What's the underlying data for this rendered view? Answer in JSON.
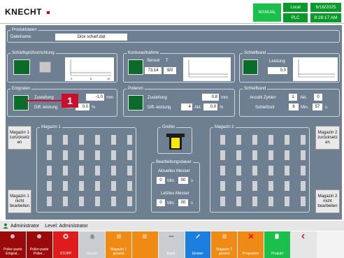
{
  "topbar": {
    "logo": "KNECHT",
    "mode": "MANUAL",
    "local": "Local",
    "plc": "PLC",
    "date": "6/16/2025",
    "time": "8:28:17 AM"
  },
  "produktdaten": {
    "title": "Produktdaten",
    "dateiname_label": "Dateiname:",
    "dateiname_value": "Dick scharf.dat"
  },
  "schaerfe": {
    "title": "Schärfeprüfvorrichtung",
    "graph_ticks": [
      "0",
      "8",
      "16"
    ]
  },
  "kontur": {
    "title": "Konturaufnahme",
    "sensor_label": "Sensor",
    "sensor_t": "T",
    "value1": "73.14",
    "value2": "9/0"
  },
  "schleifband_top": {
    "title": "Schleifband",
    "leistung_label": "Leistung",
    "leistung_value": "0.0"
  },
  "entgraten": {
    "title": "Entgraten",
    "zustellung_label": "Zustellung",
    "zustellung_value": "-1.0",
    "zustellung_unit": "mm",
    "diff_label": "Diff.-leistung",
    "akt_label": "Akt.",
    "akt_value": "0.0",
    "akt_unit": "%"
  },
  "polieren": {
    "title": "Polieren",
    "zustellung_label": "Zustellung",
    "zustellung_value": "0.8",
    "zustellung_unit": "mm",
    "diff_label": "Diff.-leistung",
    "diff_value": "4",
    "akt_label": "Akt.",
    "akt_value": "0.0",
    "akt_unit": "%"
  },
  "schleifband_bottom": {
    "title": "Schleifband",
    "zyklen_label": "Anzahl Zyklen",
    "zyklen_value": "1",
    "akt_label": "Akt.",
    "akt_value": "0",
    "schleifzeit_label": "Schleifzeit",
    "schleifzeit_value": "6",
    "min_label": "Min.",
    "sec_value": "57",
    "sec_unit": "s"
  },
  "magazin1": {
    "title": "Magazin 1",
    "reset_btn": "Magazin 1 zurücksetz en",
    "skip_btn": "Magazin 1 nicht bearbeiten"
  },
  "magazin2": {
    "title": "Magazin 2",
    "reset_btn": "Magazin 2 zurücksetz en",
    "skip_btn": "Magazin 2 nicht bearbeiten"
  },
  "greifer": {
    "title": "Greifer"
  },
  "bearbeitung": {
    "title": "Bearbeitungsdauer",
    "aktuell_label": "Aktuelles Messer",
    "aktuell_h": "0",
    "aktuell_min_label": "Min.",
    "aktuell_s": "00",
    "aktuell_s_unit": "s",
    "letztes_label": "Letztes Messer",
    "letztes_h": "0",
    "letztes_min_label": "Min.",
    "letztes_s": "00",
    "letztes_s_unit": "s"
  },
  "callout": {
    "number": "1"
  },
  "status": {
    "user": "Administrator",
    "level": "Level: Administrator"
  },
  "buttons": [
    {
      "label": "Polier-paste Entgrat...",
      "color": "#9b0a0a",
      "icon": "paste-icon"
    },
    {
      "label": "Polier-paste Polier...",
      "color": "#9b0a0a",
      "icon": "paste-icon"
    },
    {
      "label": "STOPP",
      "color": "#e01b1b",
      "icon": "stop-icon"
    },
    {
      "label": "Grund-",
      "color": "#c9cdd2",
      "icon": "home-icon"
    },
    {
      "label": "Magazin 1 gesetzt",
      "color": "#ef8a14",
      "icon": "magazine-icon"
    },
    {
      "label": "",
      "color": "#ef8a14",
      "icon": "magazine-icon"
    },
    {
      "label": "Band-",
      "color": "#c9cdd2",
      "icon": "belt-icon"
    },
    {
      "label": "Einstel-",
      "color": "#1c7fe0",
      "icon": "pencil-icon"
    },
    {
      "label": "Magazin 2 gesetzt",
      "color": "#ef8a14",
      "icon": "magazine-icon"
    },
    {
      "label": "Programm",
      "color": "#ef8a14",
      "icon": "close-icon"
    },
    {
      "label": "Produkt",
      "color": "#1ac04a",
      "icon": "file-icon"
    },
    {
      "label": "",
      "color": "#e6e6e6",
      "icon": "arrow-icon"
    }
  ],
  "colors": {
    "panel_bg": "#6f7f92",
    "green_indicator": "#0b6b2b",
    "callout_red": "#c8102e"
  }
}
